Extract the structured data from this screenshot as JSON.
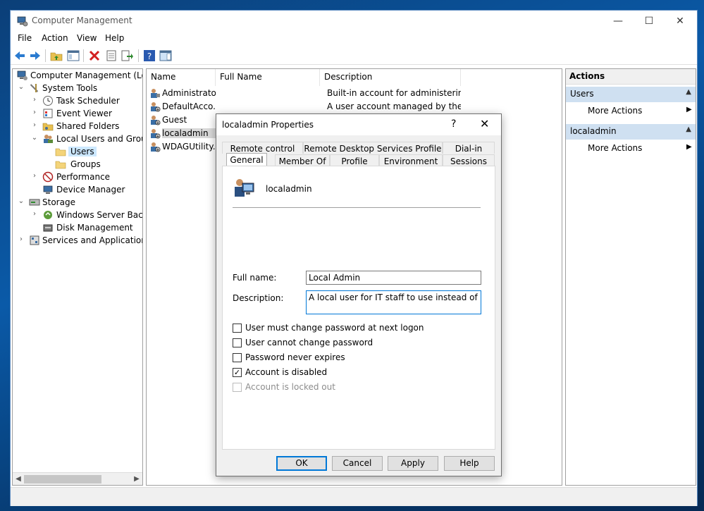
{
  "window": {
    "title": "Computer Management"
  },
  "menu": [
    "File",
    "Action",
    "View",
    "Help"
  ],
  "tree": {
    "root": "Computer Management (Local",
    "system_tools": "System Tools",
    "task_scheduler": "Task Scheduler",
    "event_viewer": "Event Viewer",
    "shared_folders": "Shared Folders",
    "local_users_groups": "Local Users and Groups",
    "users": "Users",
    "groups": "Groups",
    "performance": "Performance",
    "device_manager": "Device Manager",
    "storage": "Storage",
    "windows_server_backup": "Windows Server Backup",
    "disk_management": "Disk Management",
    "services_apps": "Services and Applications"
  },
  "list": {
    "columns": [
      "Name",
      "Full Name",
      "Description"
    ],
    "rows": [
      {
        "name": "Administrator",
        "description": "Built-in account for administering..."
      },
      {
        "name": "DefaultAcco...",
        "description": "A user account managed by the s..."
      },
      {
        "name": "Guest",
        "description": ""
      },
      {
        "name": "localadmin",
        "description": ""
      },
      {
        "name": "WDAGUtility...",
        "description": ""
      }
    ]
  },
  "actions": {
    "title": "Actions",
    "section1": "Users",
    "section1_more": "More Actions",
    "section2": "localadmin",
    "section2_more": "More Actions"
  },
  "dialog": {
    "title": "localadmin Properties",
    "help": "?",
    "tabs_top": [
      "Remote control",
      "Remote Desktop Services Profile",
      "Dial-in"
    ],
    "tabs_bottom": [
      "General",
      "Member Of",
      "Profile",
      "Environment",
      "Sessions"
    ],
    "username": "localadmin",
    "full_name_label": "Full name:",
    "full_name_value": "Local Admin",
    "description_label": "Description:",
    "description_value": "A local user for IT staff to use instead of Admin",
    "checkboxes": [
      {
        "label": "User must change password at next logon",
        "checked": false,
        "disabled": false
      },
      {
        "label": "User cannot change password",
        "checked": false,
        "disabled": false
      },
      {
        "label": "Password never expires",
        "checked": false,
        "disabled": false
      },
      {
        "label": "Account is disabled",
        "checked": true,
        "disabled": false
      },
      {
        "label": "Account is locked out",
        "checked": false,
        "disabled": true
      }
    ],
    "buttons": {
      "ok": "OK",
      "cancel": "Cancel",
      "apply": "Apply",
      "help": "Help"
    }
  }
}
